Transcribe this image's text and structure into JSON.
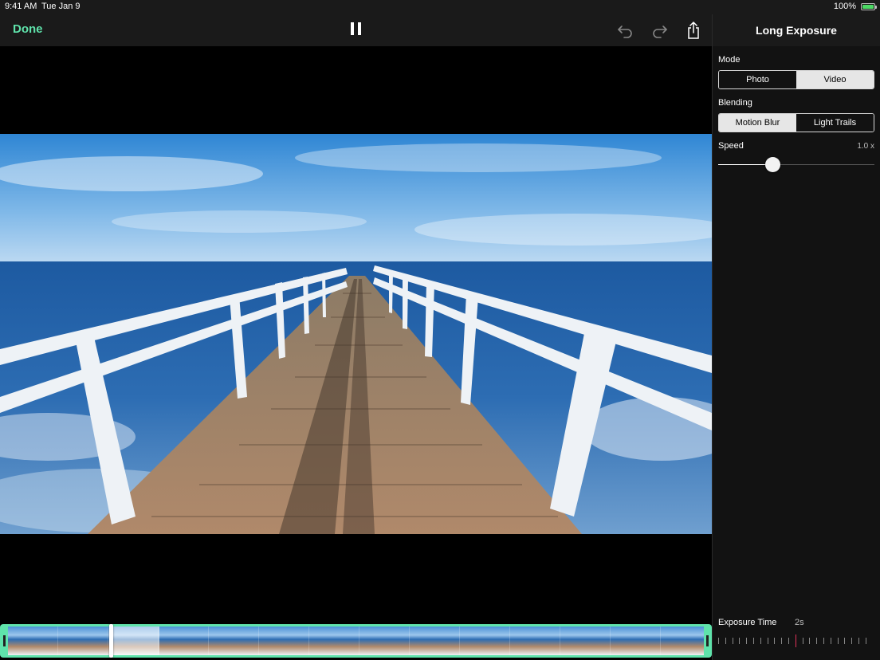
{
  "status": {
    "time": "9:41 AM",
    "date": "Tue Jan 9",
    "battery": "100%"
  },
  "toolbar": {
    "done_label": "Done"
  },
  "panel": {
    "title": "Long Exposure",
    "mode": {
      "label": "Mode",
      "options": [
        "Photo",
        "Video"
      ],
      "selected": "Video"
    },
    "blending": {
      "label": "Blending",
      "options": [
        "Motion Blur",
        "Light Trails"
      ],
      "selected": "Motion Blur"
    },
    "speed": {
      "label": "Speed",
      "value_text": "1.0 x",
      "fraction": 0.35
    },
    "exposure": {
      "label": "Exposure Time",
      "value_text": "2s"
    }
  },
  "timeline": {
    "playhead_fraction": 0.153,
    "frame_count": 14
  },
  "colors": {
    "accent": "#5fe3ab",
    "tick_marker": "#e0335a"
  },
  "icons": [
    "pause-icon",
    "undo-icon",
    "redo-icon",
    "share-icon",
    "battery-icon"
  ]
}
